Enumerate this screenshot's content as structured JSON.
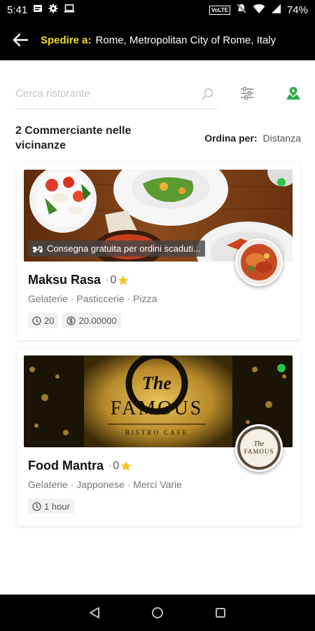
{
  "status_bar": {
    "time": "5:41",
    "battery": "74%",
    "network": "VoLTE"
  },
  "header": {
    "ship_label": "Spedire a:",
    "ship_value": "Rome, Metropolitan City of Rome, Italy"
  },
  "search": {
    "placeholder": "Cerca ristorante"
  },
  "listing": {
    "count_title": "2 Commerciante nelle vicinanze",
    "sort_label": "Ordina per:",
    "sort_value": "Distanza"
  },
  "colors": {
    "accent_yellow": "#f5dc1a",
    "online_green": "#2ec24a",
    "map_green": "#2daa4b",
    "star": "#f5c518"
  },
  "merchants": [
    {
      "name": "Maksu Rasa",
      "rating": "0",
      "categories": "Gelaterie · Pasticcerie · Pizza",
      "promo": "Consegna gratuita per ordini scaduti...",
      "time": "20",
      "min_order": "20.00000"
    },
    {
      "name": "Food Mantra",
      "rating": "0",
      "categories": "Gelaterie · Japponese · Merci Varie",
      "time": "1 hour",
      "banner_title": "The",
      "banner_brand": "FAMOUS",
      "banner_sub": "BISTRO CAFE",
      "logo_title": "The",
      "logo_brand": "FAMOUS"
    }
  ],
  "icons": [
    "back-arrow-icon",
    "search-icon",
    "filter-icon",
    "map-pin-icon",
    "star-icon",
    "clock-icon",
    "money-icon",
    "scooter-icon",
    "nav-back-icon",
    "nav-home-icon",
    "nav-recents-icon"
  ]
}
